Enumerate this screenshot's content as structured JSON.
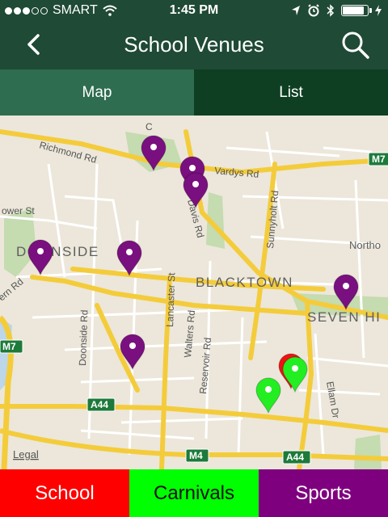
{
  "status": {
    "carrier": "SMART",
    "time": "1:45 PM",
    "icons": [
      "signal-dots-icon",
      "wifi-icon",
      "location-arrow-icon",
      "alarm-icon",
      "bluetooth-icon",
      "battery-icon",
      "charging-icon"
    ]
  },
  "nav": {
    "title": "School Venues",
    "back_icon": "chevron-left-icon",
    "search_icon": "search-icon"
  },
  "tabs": [
    {
      "label": "Map",
      "active": true
    },
    {
      "label": "List",
      "active": false
    }
  ],
  "map": {
    "legal_label": "Legal",
    "place_labels": {
      "doonside": "DOONSIDE",
      "blacktown": "BLACKTOWN",
      "seven_hills": "SEVEN HI",
      "northmead": "Northo"
    },
    "road_labels": {
      "richmond": "Richmond Rd",
      "vardys": "Vardys Rd",
      "davis": "Davis Rd",
      "sunnyholt": "Sunnyholt Rd",
      "lancaster": "Lancaster St",
      "walters": "Walters Rd",
      "reservoir": "Reservoir Rd",
      "doonside_rd": "Doonside Rd",
      "ellam": "Ellam Dr",
      "power": "ower St",
      "cn_rd": "ern Rd",
      "conrad": "C"
    },
    "motorway_badges": [
      "M7",
      "M7",
      "A44",
      "M4",
      "A44"
    ],
    "pins": [
      {
        "category": "sports",
        "color": "#7a0f7f"
      },
      {
        "category": "sports",
        "color": "#7a0f7f"
      },
      {
        "category": "sports",
        "color": "#7a0f7f"
      },
      {
        "category": "sports",
        "color": "#7a0f7f"
      },
      {
        "category": "sports",
        "color": "#7a0f7f"
      },
      {
        "category": "sports",
        "color": "#7a0f7f"
      },
      {
        "category": "sports",
        "color": "#7a0f7f"
      },
      {
        "category": "school",
        "color": "#ef1212"
      },
      {
        "category": "carnivals",
        "color": "#22ee22"
      },
      {
        "category": "carnivals",
        "color": "#22ee22"
      }
    ]
  },
  "bottom": [
    {
      "label": "School",
      "bg": "#ff0000",
      "fg": "#ffffff"
    },
    {
      "label": "Carnivals",
      "bg": "#00ff00",
      "fg": "#111111"
    },
    {
      "label": "Sports",
      "bg": "#7f007f",
      "fg": "#ffffff"
    }
  ],
  "colors": {
    "header_bg": "#1f4a35",
    "tab_active": "#2e6d4f",
    "tab_inactive": "#0f3f23",
    "map_bg": "#ece7da",
    "major_road": "#f4cc3b",
    "minor_road": "#ffffff",
    "park": "#c5dbb0"
  }
}
